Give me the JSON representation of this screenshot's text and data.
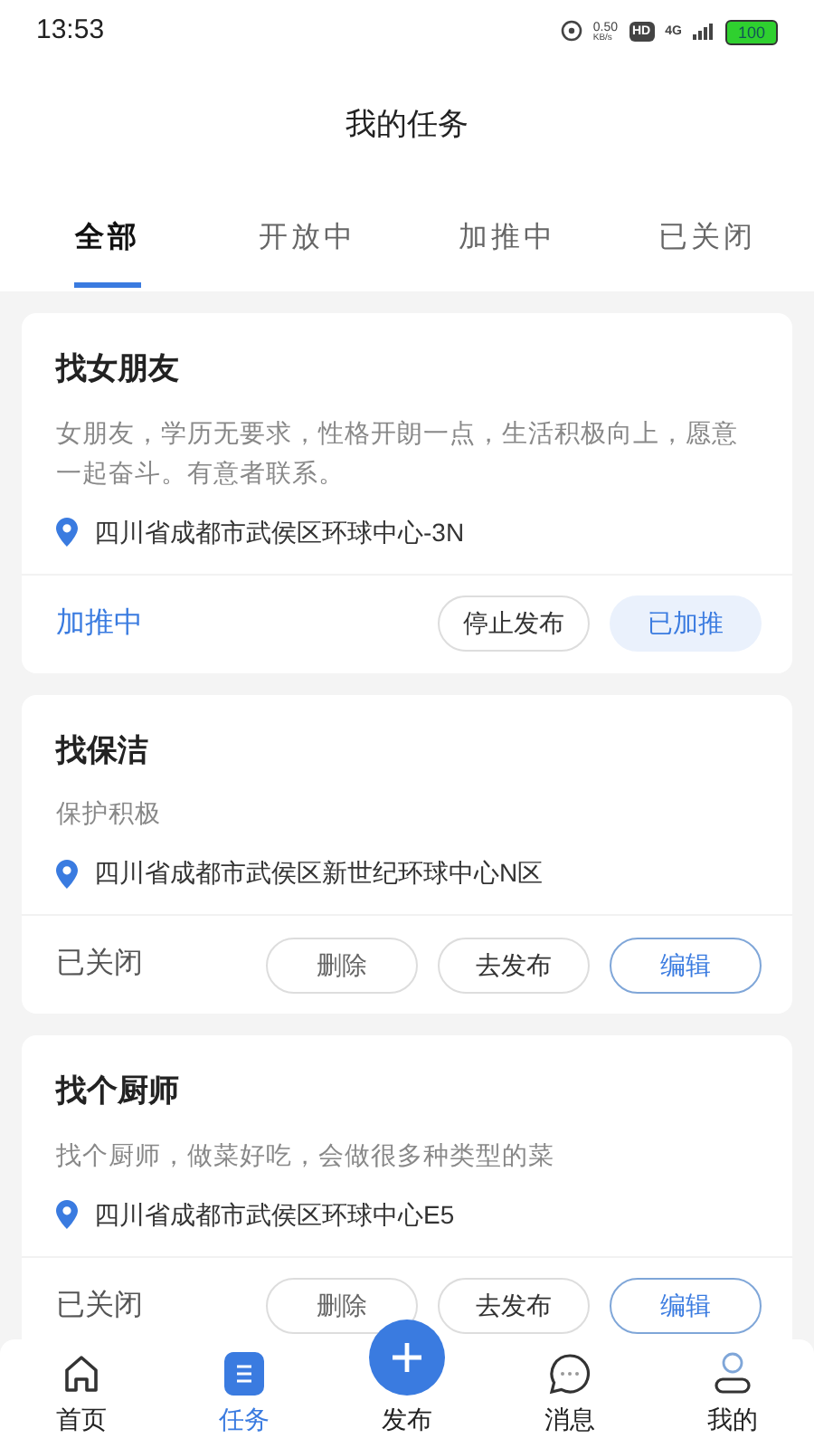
{
  "status_bar": {
    "time": "13:53",
    "net_speed": "0.50",
    "net_unit": "KB/s",
    "hd": "HD",
    "network": "4G",
    "battery": "100"
  },
  "title": "我的任务",
  "tabs": [
    {
      "label": "全部",
      "selected": true
    },
    {
      "label": "开放中",
      "selected": false
    },
    {
      "label": "加推中",
      "selected": false
    },
    {
      "label": "已关闭",
      "selected": false
    }
  ],
  "tasks": [
    {
      "title": "找女朋友",
      "description": "女朋友，学历无要求，性格开朗一点，生活积极向上，愿意一起奋斗。有意者联系。",
      "location": "四川省成都市武侯区环球中心-3N",
      "status": {
        "label": "加推中",
        "kind": "promoting"
      },
      "actions": [
        {
          "label": "停止发布",
          "kind": "outline"
        },
        {
          "label": "已加推",
          "kind": "soft"
        }
      ]
    },
    {
      "title": "找保洁",
      "description": "保护积极",
      "location": "四川省成都市武侯区新世纪环球中心N区",
      "status": {
        "label": "已关闭",
        "kind": "closed"
      },
      "actions": [
        {
          "label": "删除",
          "kind": "outline-muted"
        },
        {
          "label": "去发布",
          "kind": "outline"
        },
        {
          "label": "编辑",
          "kind": "primary-outline"
        }
      ]
    },
    {
      "title": "找个厨师",
      "description": "找个厨师，做菜好吃，会做很多种类型的菜",
      "location": "四川省成都市武侯区环球中心E5",
      "status": {
        "label": "已关闭",
        "kind": "closed"
      },
      "actions": [
        {
          "label": "删除",
          "kind": "outline-muted"
        },
        {
          "label": "去发布",
          "kind": "outline"
        },
        {
          "label": "编辑",
          "kind": "primary-outline"
        }
      ]
    }
  ],
  "nav": [
    {
      "label": "首页",
      "kind": "home",
      "selected": false
    },
    {
      "label": "任务",
      "kind": "tasks",
      "selected": true
    },
    {
      "label": "发布",
      "kind": "publish",
      "selected": false
    },
    {
      "label": "消息",
      "kind": "messages",
      "selected": false
    },
    {
      "label": "我的",
      "kind": "profile",
      "selected": false
    }
  ]
}
